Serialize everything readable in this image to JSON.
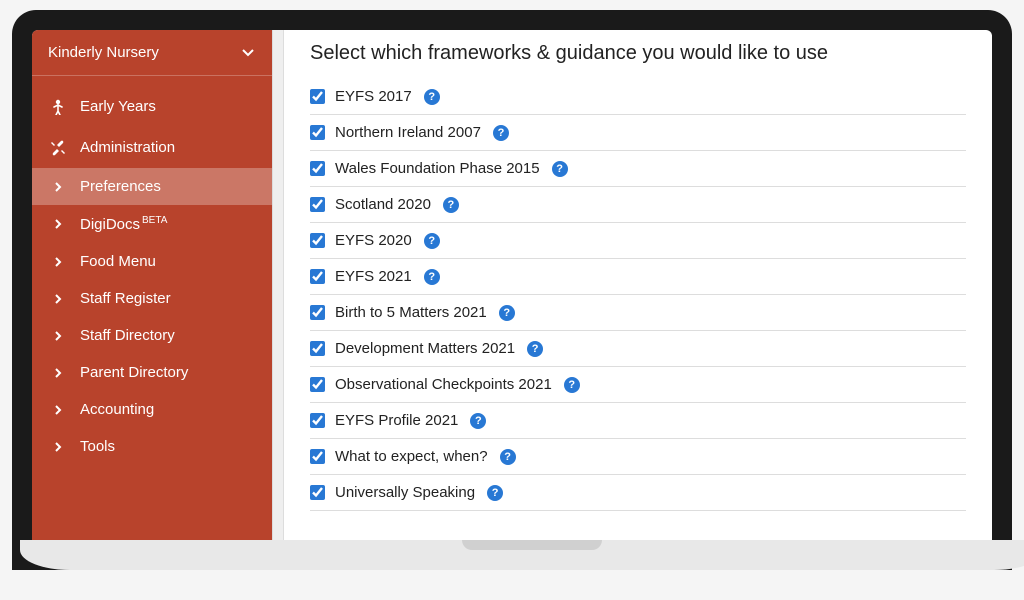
{
  "sidebar": {
    "org_name": "Kinderly Nursery",
    "items": [
      {
        "label": "Early Years",
        "icon": "child"
      },
      {
        "label": "Administration",
        "icon": "tools"
      }
    ],
    "subitems": [
      {
        "label": "Preferences",
        "active": true
      },
      {
        "label": "DigiDocs",
        "badge": "BETA"
      },
      {
        "label": "Food Menu"
      },
      {
        "label": "Staff Register"
      },
      {
        "label": "Staff Directory"
      },
      {
        "label": "Parent Directory"
      },
      {
        "label": "Accounting"
      },
      {
        "label": "Tools"
      }
    ]
  },
  "main": {
    "heading": "Select which frameworks & guidance you would like to use",
    "frameworks": [
      {
        "label": "EYFS 2017",
        "checked": true
      },
      {
        "label": "Northern Ireland 2007",
        "checked": true
      },
      {
        "label": "Wales Foundation Phase 2015",
        "checked": true
      },
      {
        "label": "Scotland 2020",
        "checked": true
      },
      {
        "label": "EYFS 2020",
        "checked": true
      },
      {
        "label": "EYFS 2021",
        "checked": true
      },
      {
        "label": "Birth to 5 Matters 2021",
        "checked": true
      },
      {
        "label": "Development Matters 2021",
        "checked": true
      },
      {
        "label": "Observational Checkpoints 2021",
        "checked": true
      },
      {
        "label": "EYFS Profile 2021",
        "checked": true
      },
      {
        "label": "What to expect, when?",
        "checked": true
      },
      {
        "label": "Universally Speaking",
        "checked": true
      }
    ]
  }
}
